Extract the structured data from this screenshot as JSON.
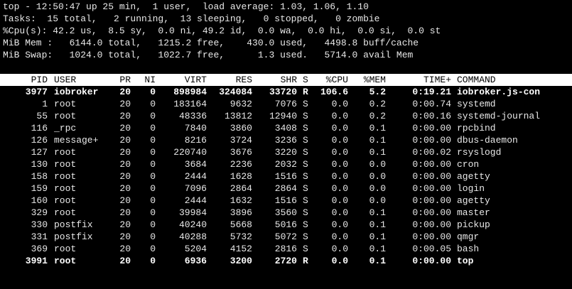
{
  "summary": {
    "line1": "top - 12:50:47 up 25 min,  1 user,  load average: 1.03, 1.06, 1.10",
    "line2": "Tasks:  15 total,   2 running,  13 sleeping,   0 stopped,   0 zombie",
    "line3": "%Cpu(s): 42.2 us,  8.5 sy,  0.0 ni, 49.2 id,  0.0 wa,  0.0 hi,  0.0 si,  0.0 st",
    "line4": "MiB Mem :   6144.0 total,   1215.2 free,    430.0 used,   4498.8 buff/cache",
    "line5": "MiB Swap:   1024.0 total,   1022.7 free,      1.3 used.   5714.0 avail Mem"
  },
  "columns": {
    "pid": "PID",
    "user": "USER",
    "pr": "PR",
    "ni": "NI",
    "virt": "VIRT",
    "res": "RES",
    "shr": "SHR",
    "s": "S",
    "cpu": "%CPU",
    "mem": "%MEM",
    "time": "TIME+",
    "command": "COMMAND"
  },
  "processes": [
    {
      "pid": "3977",
      "user": "iobroker",
      "pr": "20",
      "ni": "0",
      "virt": "898984",
      "res": "324084",
      "shr": "33720",
      "s": "R",
      "cpu": "106.6",
      "mem": "5.2",
      "time": "0:19.21",
      "command": "iobroker.js-con",
      "running": true
    },
    {
      "pid": "1",
      "user": "root",
      "pr": "20",
      "ni": "0",
      "virt": "183164",
      "res": "9632",
      "shr": "7076",
      "s": "S",
      "cpu": "0.0",
      "mem": "0.2",
      "time": "0:00.74",
      "command": "systemd",
      "running": false
    },
    {
      "pid": "55",
      "user": "root",
      "pr": "20",
      "ni": "0",
      "virt": "48336",
      "res": "13812",
      "shr": "12940",
      "s": "S",
      "cpu": "0.0",
      "mem": "0.2",
      "time": "0:00.16",
      "command": "systemd-journal",
      "running": false
    },
    {
      "pid": "116",
      "user": "_rpc",
      "pr": "20",
      "ni": "0",
      "virt": "7840",
      "res": "3860",
      "shr": "3408",
      "s": "S",
      "cpu": "0.0",
      "mem": "0.1",
      "time": "0:00.00",
      "command": "rpcbind",
      "running": false
    },
    {
      "pid": "126",
      "user": "message+",
      "pr": "20",
      "ni": "0",
      "virt": "8216",
      "res": "3724",
      "shr": "3236",
      "s": "S",
      "cpu": "0.0",
      "mem": "0.1",
      "time": "0:00.00",
      "command": "dbus-daemon",
      "running": false
    },
    {
      "pid": "127",
      "user": "root",
      "pr": "20",
      "ni": "0",
      "virt": "220740",
      "res": "3676",
      "shr": "3220",
      "s": "S",
      "cpu": "0.0",
      "mem": "0.1",
      "time": "0:00.02",
      "command": "rsyslogd",
      "running": false
    },
    {
      "pid": "130",
      "user": "root",
      "pr": "20",
      "ni": "0",
      "virt": "3684",
      "res": "2236",
      "shr": "2032",
      "s": "S",
      "cpu": "0.0",
      "mem": "0.0",
      "time": "0:00.00",
      "command": "cron",
      "running": false
    },
    {
      "pid": "158",
      "user": "root",
      "pr": "20",
      "ni": "0",
      "virt": "2444",
      "res": "1628",
      "shr": "1516",
      "s": "S",
      "cpu": "0.0",
      "mem": "0.0",
      "time": "0:00.00",
      "command": "agetty",
      "running": false
    },
    {
      "pid": "159",
      "user": "root",
      "pr": "20",
      "ni": "0",
      "virt": "7096",
      "res": "2864",
      "shr": "2864",
      "s": "S",
      "cpu": "0.0",
      "mem": "0.0",
      "time": "0:00.00",
      "command": "login",
      "running": false
    },
    {
      "pid": "160",
      "user": "root",
      "pr": "20",
      "ni": "0",
      "virt": "2444",
      "res": "1632",
      "shr": "1516",
      "s": "S",
      "cpu": "0.0",
      "mem": "0.0",
      "time": "0:00.00",
      "command": "agetty",
      "running": false
    },
    {
      "pid": "329",
      "user": "root",
      "pr": "20",
      "ni": "0",
      "virt": "39984",
      "res": "3896",
      "shr": "3560",
      "s": "S",
      "cpu": "0.0",
      "mem": "0.1",
      "time": "0:00.00",
      "command": "master",
      "running": false
    },
    {
      "pid": "330",
      "user": "postfix",
      "pr": "20",
      "ni": "0",
      "virt": "40240",
      "res": "5668",
      "shr": "5016",
      "s": "S",
      "cpu": "0.0",
      "mem": "0.1",
      "time": "0:00.00",
      "command": "pickup",
      "running": false
    },
    {
      "pid": "331",
      "user": "postfix",
      "pr": "20",
      "ni": "0",
      "virt": "40288",
      "res": "5732",
      "shr": "5072",
      "s": "S",
      "cpu": "0.0",
      "mem": "0.1",
      "time": "0:00.00",
      "command": "qmgr",
      "running": false
    },
    {
      "pid": "369",
      "user": "root",
      "pr": "20",
      "ni": "0",
      "virt": "5204",
      "res": "4152",
      "shr": "2816",
      "s": "S",
      "cpu": "0.0",
      "mem": "0.1",
      "time": "0:00.05",
      "command": "bash",
      "running": false
    },
    {
      "pid": "3991",
      "user": "root",
      "pr": "20",
      "ni": "0",
      "virt": "6936",
      "res": "3200",
      "shr": "2720",
      "s": "R",
      "cpu": "0.0",
      "mem": "0.1",
      "time": "0:00.00",
      "command": "top",
      "running": true
    }
  ],
  "colors": {
    "background": "#000000",
    "foreground": "#e8e8e8",
    "header_bar": "#ffffff",
    "header_text": "#000000"
  }
}
